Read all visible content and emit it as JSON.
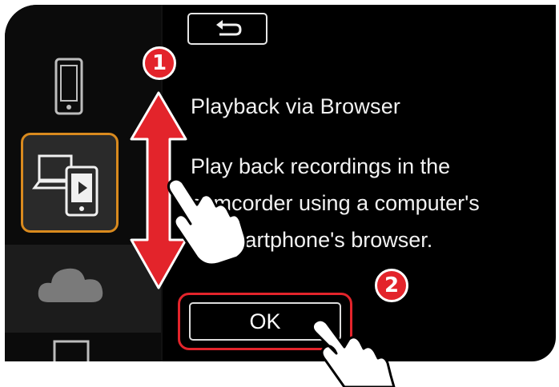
{
  "menu": {
    "items": [
      {
        "name": "smartphone",
        "icon": "smartphone-icon",
        "selected": false
      },
      {
        "name": "playback-via-browser",
        "icon": "computer-smartphone-play-icon",
        "selected": true
      },
      {
        "name": "cloud",
        "icon": "cloud-icon",
        "selected": false
      },
      {
        "name": "computer",
        "icon": "monitor-icon",
        "selected": false
      }
    ]
  },
  "back_button": {
    "icon": "return-arrow-icon"
  },
  "content": {
    "title": "Playback via Browser",
    "description": "Play back recordings in the\ncamcorder using a computer's\nor smartphone's browser."
  },
  "ok_button": {
    "label": "OK"
  },
  "steps": {
    "step1": "1",
    "step2": "2"
  },
  "colors": {
    "accent_red": "#e3242b",
    "selection_orange": "#d98a1e",
    "screen_bg": "#000000"
  }
}
